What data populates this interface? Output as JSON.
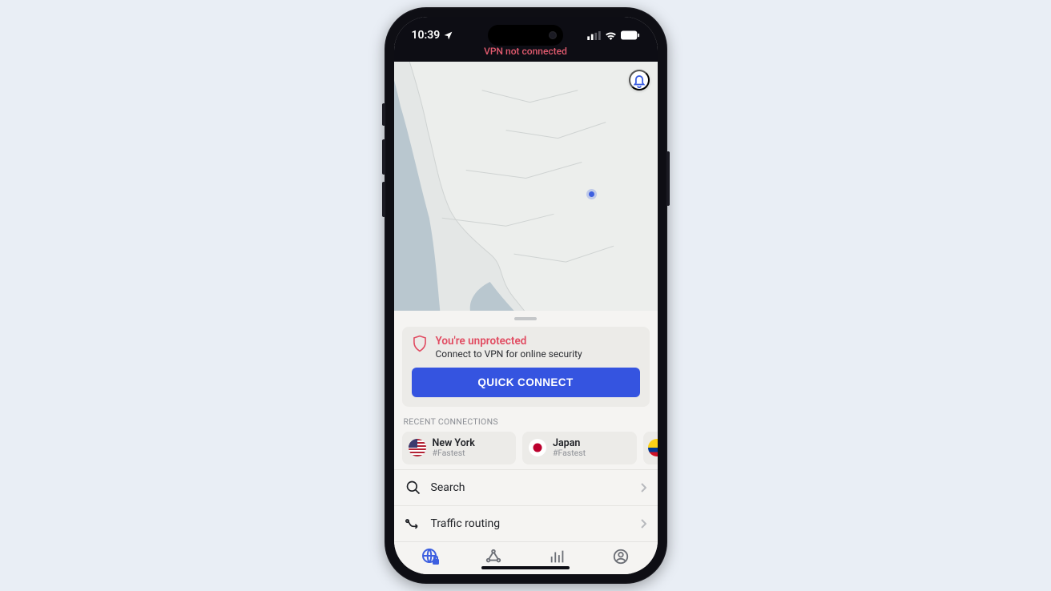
{
  "status_bar": {
    "time": "10:39"
  },
  "banner": {
    "text": "VPN not connected"
  },
  "protection": {
    "title": "You're unprotected",
    "subtitle": "Connect to VPN for online security"
  },
  "quick_connect": {
    "label": "QUICK CONNECT"
  },
  "recent": {
    "heading": "RECENT CONNECTIONS",
    "items": [
      {
        "name": "New York",
        "tag": "#Fastest",
        "flag": "us"
      },
      {
        "name": "Japan",
        "tag": "#Fastest",
        "flag": "jp"
      },
      {
        "name": "",
        "tag": "",
        "flag": "co"
      }
    ]
  },
  "menu": {
    "search": "Search",
    "traffic": "Traffic routing"
  },
  "colors": {
    "accent": "#3554e0",
    "danger": "#e14b61"
  }
}
